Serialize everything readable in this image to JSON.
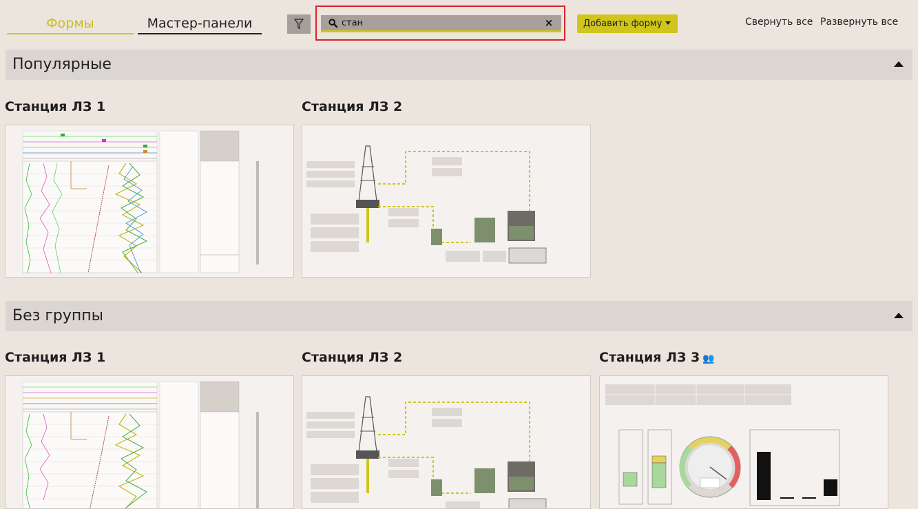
{
  "tabs": [
    {
      "label": "Формы",
      "active": true
    },
    {
      "label": "Мастер-панели",
      "active": false
    }
  ],
  "search": {
    "value": "стан",
    "placeholder": ""
  },
  "toolbar": {
    "add_form_label": "Добавить форму",
    "collapse_all_label": "Свернуть все",
    "expand_all_label": "Развернуть все"
  },
  "groups": [
    {
      "title": "Популярные",
      "cards": [
        {
          "title": "Станция ЛЗ 1"
        },
        {
          "title": "Станция ЛЗ 2"
        }
      ]
    },
    {
      "title": "Без группы",
      "cards": [
        {
          "title": "Станция ЛЗ 1"
        },
        {
          "title": "Станция ЛЗ 2"
        },
        {
          "title": "Станция ЛЗ 3",
          "icon": "users-icon"
        }
      ]
    }
  ],
  "colors": {
    "background": "#ece5dd",
    "accent": "#cfc51d",
    "group_header": "#dcd6d2",
    "search_highlight": "#d8232a"
  }
}
